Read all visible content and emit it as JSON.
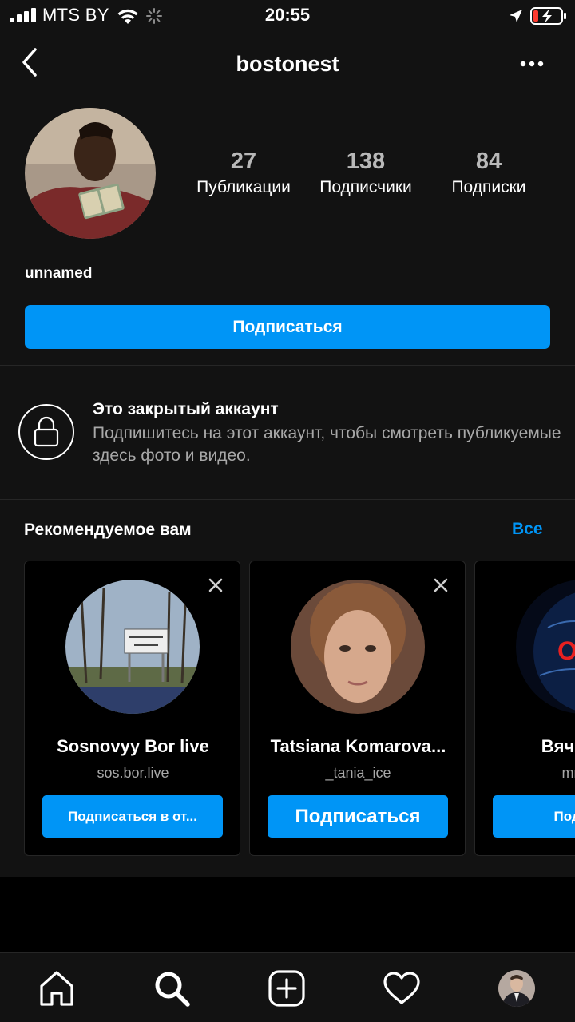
{
  "status_bar": {
    "carrier": "MTS BY",
    "time": "20:55",
    "icons": [
      "signal-icon",
      "wifi-icon",
      "loading-spinner-icon",
      "location-arrow-icon",
      "battery-charging-icon"
    ]
  },
  "header": {
    "title": "bostonest",
    "icons": [
      "chevron-left-icon",
      "more-dots-icon"
    ]
  },
  "profile": {
    "stats": [
      {
        "value": "27",
        "label": "Публикации"
      },
      {
        "value": "138",
        "label": "Подписчики"
      },
      {
        "value": "84",
        "label": "Подписки"
      }
    ],
    "name": "unnamed",
    "follow_label": "Подписаться"
  },
  "private_notice": {
    "title": "Это закрытый аккаунт",
    "description": "Подпишитесь на этот аккаунт, чтобы смотреть публикуемые здесь фото и видео.",
    "icon": "lock-icon"
  },
  "suggestions": {
    "title": "Рекомендуемое вам",
    "see_all": "Все",
    "cards": [
      {
        "name": "Sosnovyy Bor live",
        "username": "sos.bor.live",
        "button": "Подписаться в от..."
      },
      {
        "name": "Tatsiana Komarova...",
        "username": "_tania_ice",
        "button": "Подписаться"
      },
      {
        "name": "Вячеслав",
        "username": "mr.dov",
        "button": "Подписа",
        "avatar_text": "OLY"
      }
    ]
  },
  "colors": {
    "accent": "#0095f6",
    "background": "#121212",
    "secondary_text": "#a8a8a8"
  },
  "tab_bar": {
    "items": [
      "home-icon",
      "search-icon",
      "new-post-icon",
      "activity-heart-icon",
      "profile-avatar"
    ]
  }
}
